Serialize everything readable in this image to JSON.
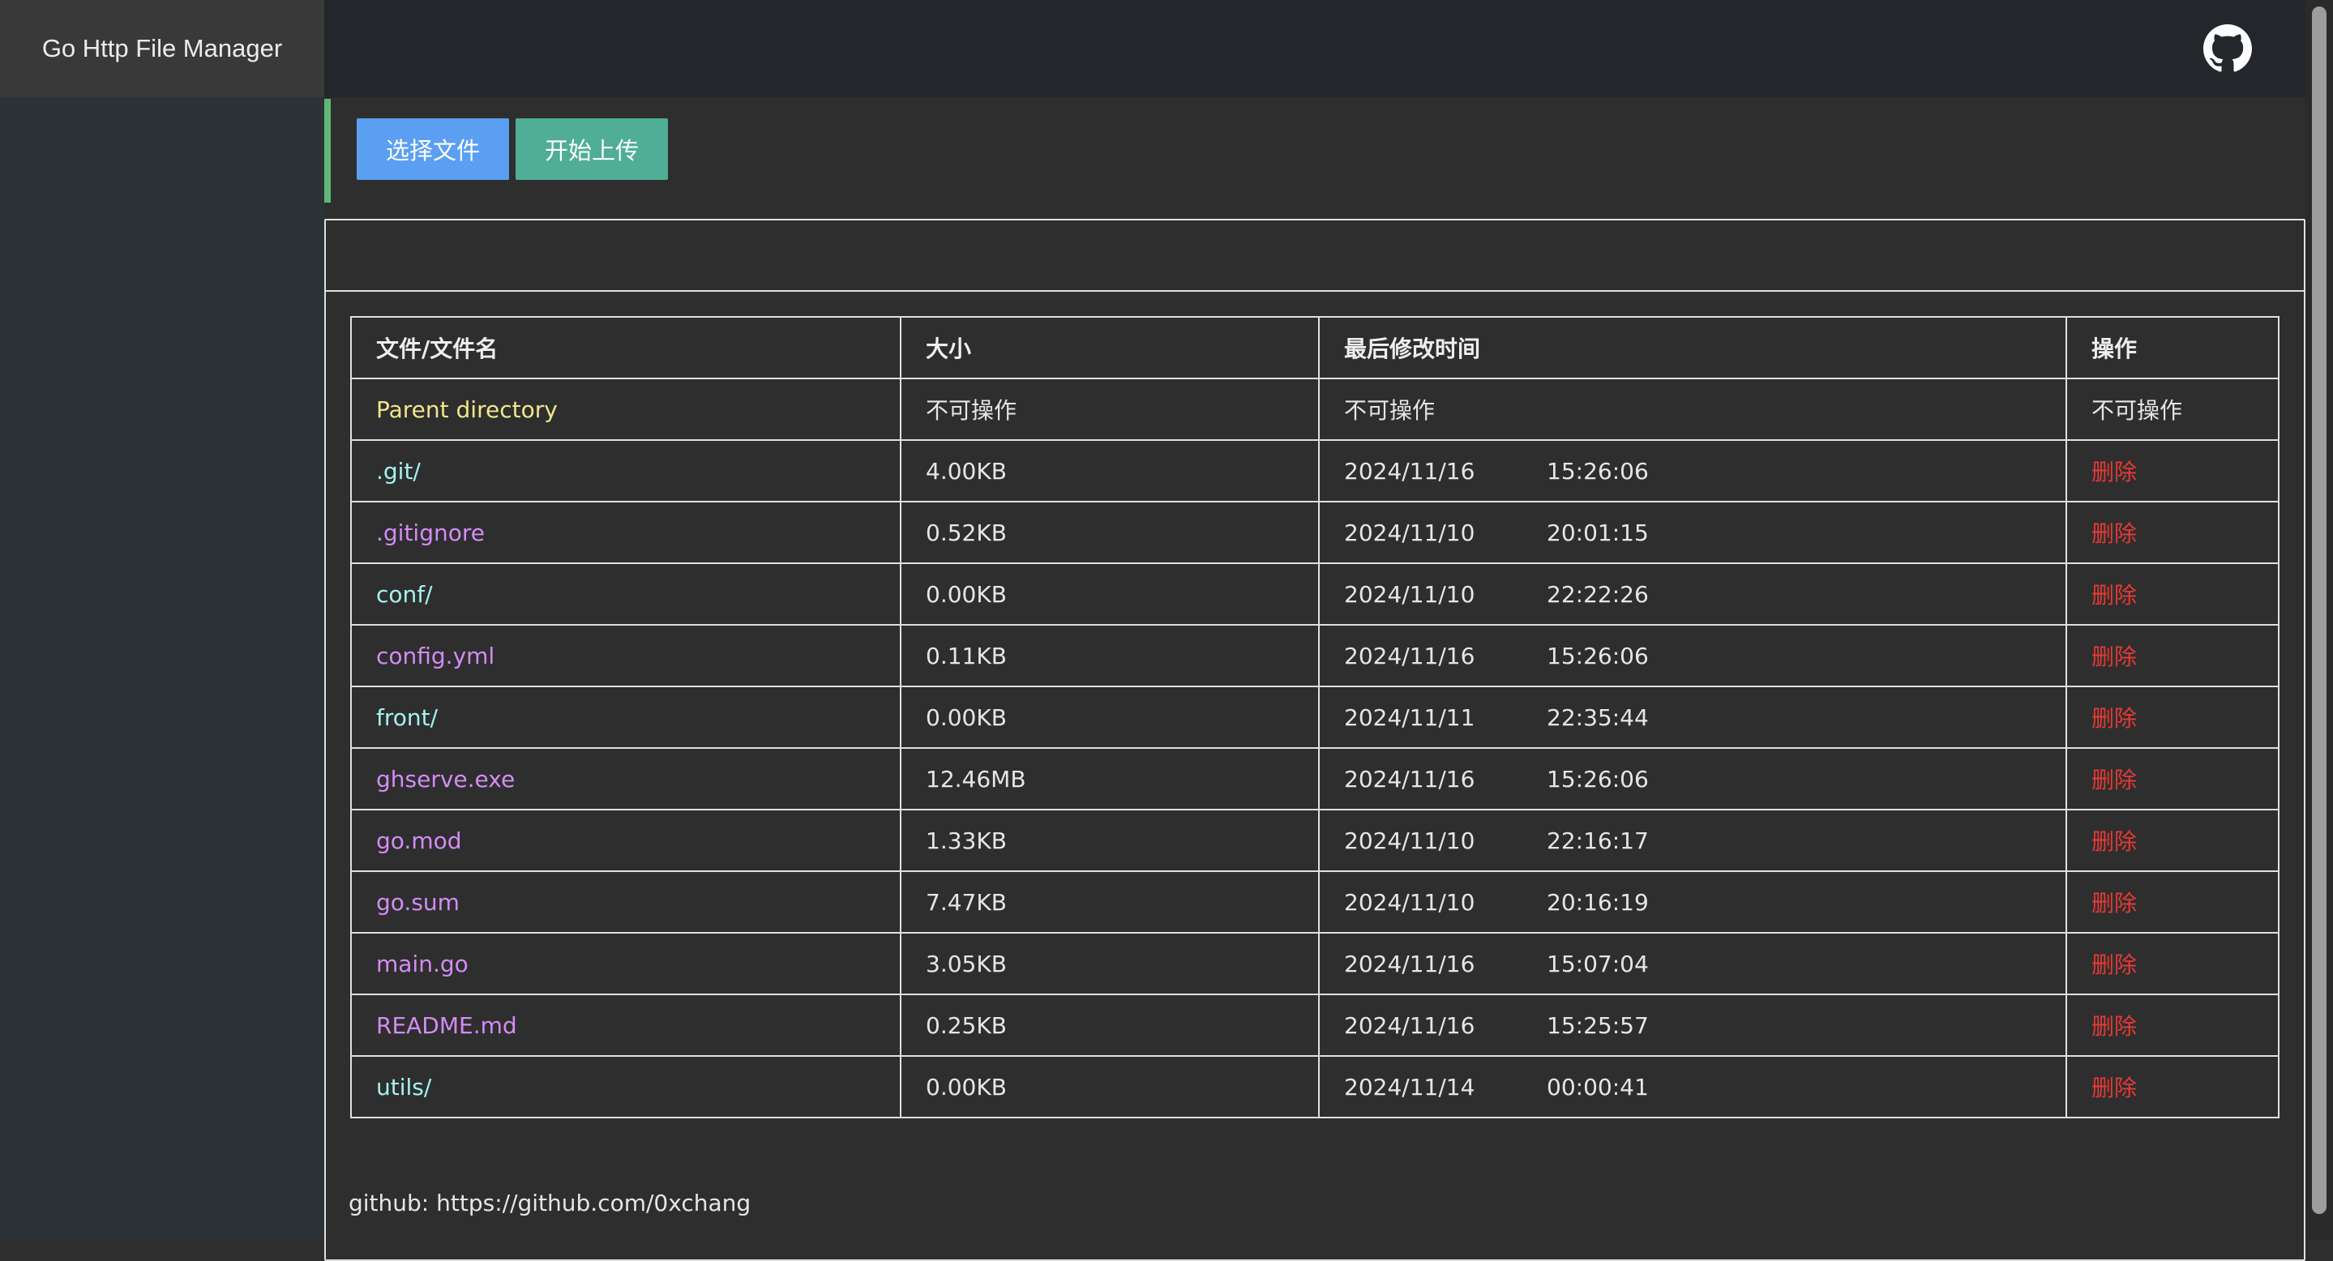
{
  "app": {
    "title": "Go Http File Manager"
  },
  "toolbar": {
    "select_label": "选择文件",
    "upload_label": "开始上传"
  },
  "table": {
    "headers": {
      "name": "文件/文件名",
      "size": "大小",
      "modified": "最后修改时间",
      "action": "操作"
    },
    "rows": [
      {
        "name": "Parent directory",
        "kind": "parent",
        "size": "不可操作",
        "date": "不可操作",
        "time": "",
        "action": "不可操作"
      },
      {
        "name": ".git/",
        "kind": "dir",
        "size": "4.00KB",
        "date": "2024/11/16",
        "time": "15:26:06",
        "action": "删除"
      },
      {
        "name": ".gitignore",
        "kind": "file",
        "size": "0.52KB",
        "date": "2024/11/10",
        "time": "20:01:15",
        "action": "删除"
      },
      {
        "name": "conf/",
        "kind": "dir",
        "size": "0.00KB",
        "date": "2024/11/10",
        "time": "22:22:26",
        "action": "删除"
      },
      {
        "name": "config.yml",
        "kind": "file",
        "size": "0.11KB",
        "date": "2024/11/16",
        "time": "15:26:06",
        "action": "删除"
      },
      {
        "name": "front/",
        "kind": "dir",
        "size": "0.00KB",
        "date": "2024/11/11",
        "time": "22:35:44",
        "action": "删除"
      },
      {
        "name": "ghserve.exe",
        "kind": "file",
        "size": "12.46MB",
        "date": "2024/11/16",
        "time": "15:26:06",
        "action": "删除"
      },
      {
        "name": "go.mod",
        "kind": "file",
        "size": "1.33KB",
        "date": "2024/11/10",
        "time": "22:16:17",
        "action": "删除"
      },
      {
        "name": "go.sum",
        "kind": "file",
        "size": "7.47KB",
        "date": "2024/11/10",
        "time": "20:16:19",
        "action": "删除"
      },
      {
        "name": "main.go",
        "kind": "file",
        "size": "3.05KB",
        "date": "2024/11/16",
        "time": "15:07:04",
        "action": "删除"
      },
      {
        "name": "README.md",
        "kind": "file",
        "size": "0.25KB",
        "date": "2024/11/16",
        "time": "15:25:57",
        "action": "删除"
      },
      {
        "name": "utils/",
        "kind": "dir",
        "size": "0.00KB",
        "date": "2024/11/14",
        "time": "00:00:41",
        "action": "删除"
      }
    ]
  },
  "footer": {
    "text": "github: https://github.com/0xchang"
  },
  "icons": {
    "github": "github-icon"
  },
  "colors": {
    "accent": "#5fb878",
    "select_button": "#5b9ff2",
    "upload_button": "#4fae95",
    "parent": "#f0e68c",
    "directory": "#a4f2ef",
    "file": "#d38cf5",
    "delete": "#e53935"
  }
}
